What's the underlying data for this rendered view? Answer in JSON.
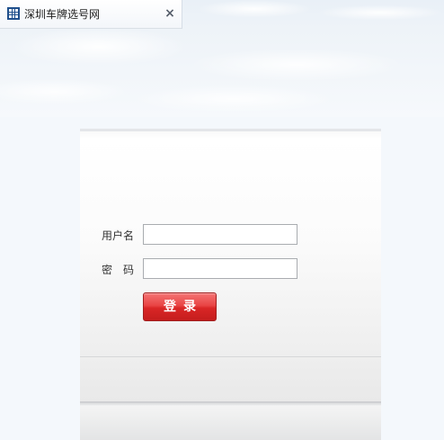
{
  "tab": {
    "title": "深圳车牌选号网",
    "icon": "grid-icon",
    "close_symbol": "×",
    "close_icon": "close-icon"
  },
  "login": {
    "username_label": "用户名",
    "username_value": "",
    "password_label": "密码",
    "password_value": "",
    "submit_label": "登录"
  },
  "colors": {
    "accent_button": "#d92626",
    "tab_icon": "#1f4f8c",
    "background": "#f4f8fc"
  }
}
